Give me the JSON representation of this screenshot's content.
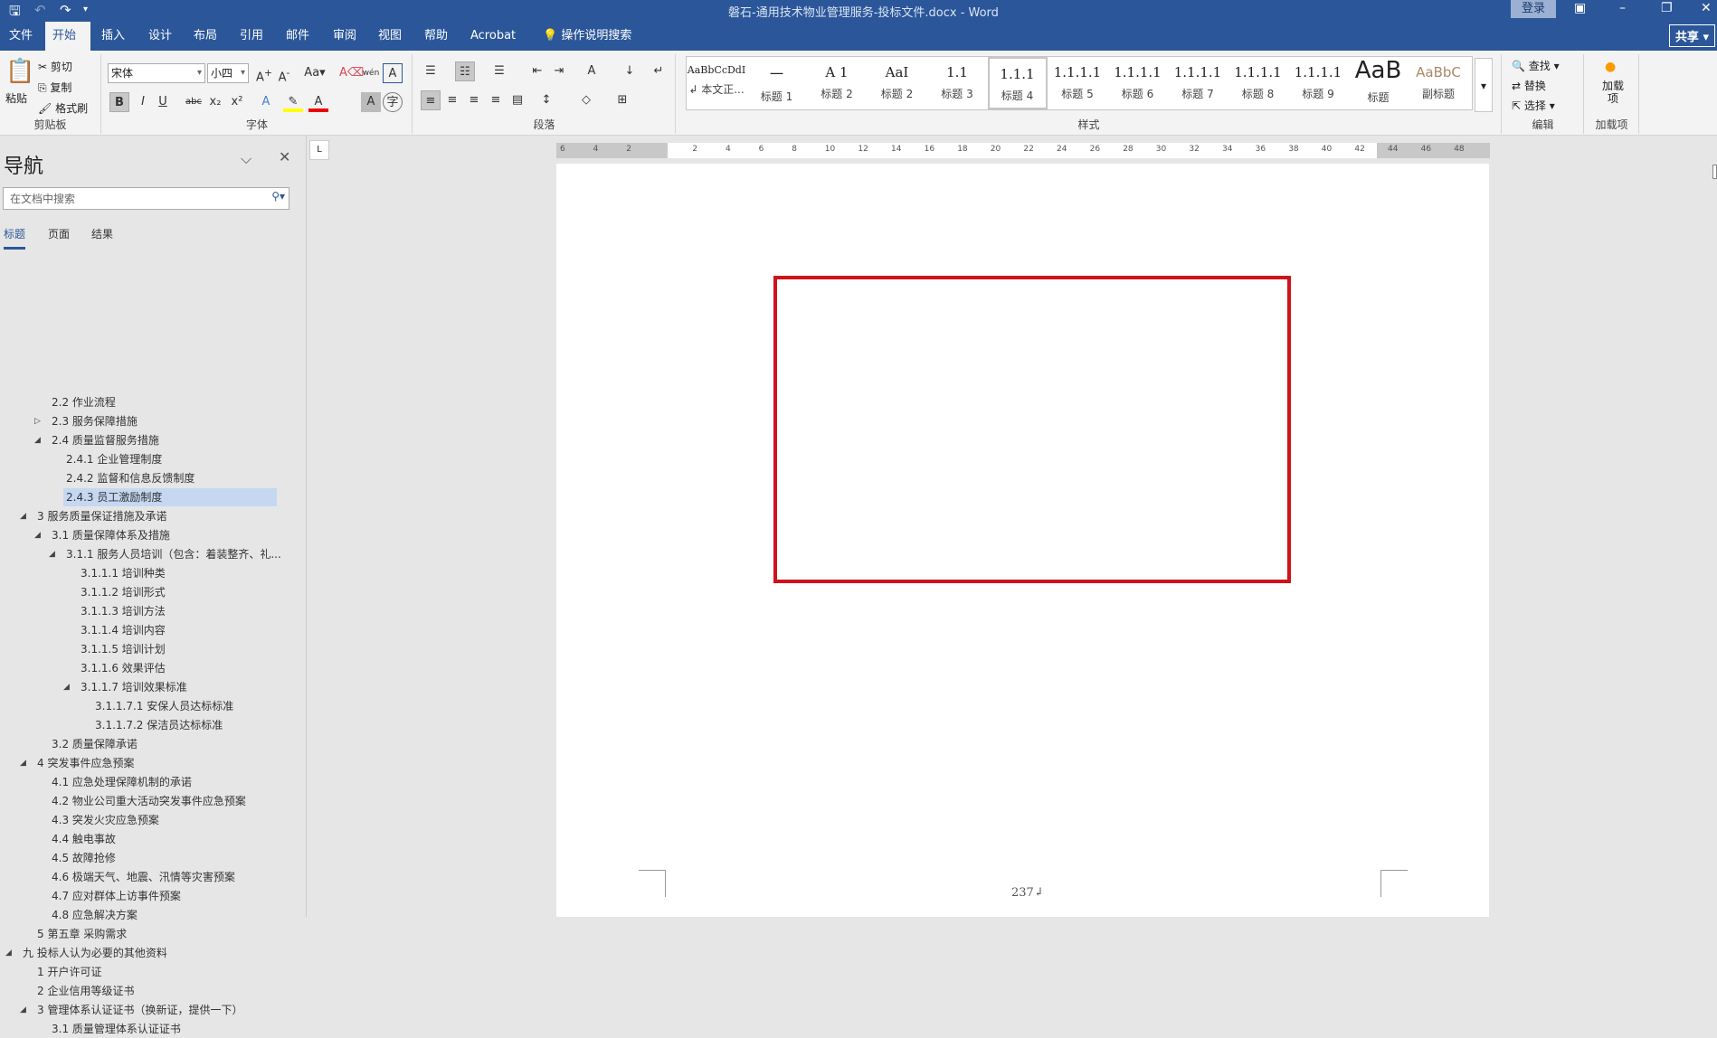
{
  "titlebar": {
    "title": "磐石-通用技术物业管理服务-投标文件.docx  -  Word",
    "login": "登录",
    "qat": {
      "save": "🖫",
      "undo": "↶",
      "redo": "↷",
      "customize": "▾"
    }
  },
  "tabs": [
    "文件",
    "开始",
    "插入",
    "设计",
    "布局",
    "引用",
    "邮件",
    "审阅",
    "视图",
    "帮助",
    "Acrobat"
  ],
  "tell_me": "操作说明搜索",
  "share": "共享",
  "clipboard": {
    "paste": "粘贴",
    "cut": "剪切",
    "copy": "复制",
    "format_painter": "格式刷",
    "label": "剪贴板"
  },
  "font": {
    "name": "宋体",
    "size": "小四",
    "label": "字体"
  },
  "paragraph": {
    "label": "段落"
  },
  "styles": {
    "label": "样式",
    "items": [
      {
        "preview": "AaBbCcDdI",
        "name": "↲ 本文正..."
      },
      {
        "preview": "一",
        "name": "标题 1"
      },
      {
        "preview": "A 1",
        "name": "标题 2"
      },
      {
        "preview": "AaI",
        "name": "标题 2"
      },
      {
        "preview": "1.1",
        "name": "标题 3"
      },
      {
        "preview": "1.1.1",
        "name": "标题 4"
      },
      {
        "preview": "1.1.1.1",
        "name": "标题 5"
      },
      {
        "preview": "1.1.1.1",
        "name": "标题 6"
      },
      {
        "preview": "1.1.1.1",
        "name": "标题 7"
      },
      {
        "preview": "1.1.1.1",
        "name": "标题 8"
      },
      {
        "preview": "1.1.1.1",
        "name": "标题 9"
      },
      {
        "preview": "AaB",
        "name": "标题"
      },
      {
        "preview": "AaBbC",
        "name": "副标题"
      }
    ]
  },
  "editing": {
    "find": "查找",
    "replace": "替换",
    "select": "选择",
    "label": "编辑"
  },
  "addins": {
    "button": "加载项",
    "label": "加载项"
  },
  "nav": {
    "title": "导航",
    "search_placeholder": "在文档中搜索",
    "tabs": [
      "标题",
      "页面",
      "结果"
    ],
    "items": [
      {
        "t": "2.2 作业流程",
        "l": 2,
        "a": ""
      },
      {
        "t": "2.3 服务保障措施",
        "l": 2,
        "a": "▷"
      },
      {
        "t": "2.4 质量监督服务措施",
        "l": 2,
        "a": "◢"
      },
      {
        "t": "2.4.1 企业管理制度",
        "l": 3,
        "a": ""
      },
      {
        "t": "2.4.2 监督和信息反馈制度",
        "l": 3,
        "a": ""
      },
      {
        "t": "2.4.3 员工激励制度",
        "l": 3,
        "a": "",
        "sel": true
      },
      {
        "t": "3 服务质量保证措施及承诺",
        "l": 1,
        "a": "◢"
      },
      {
        "t": "3.1 质量保障体系及措施",
        "l": 2,
        "a": "◢"
      },
      {
        "t": "3.1.1 服务人员培训（包含：着装整齐、礼...",
        "l": 3,
        "a": "◢"
      },
      {
        "t": "3.1.1.1 培训种类",
        "l": 4,
        "a": ""
      },
      {
        "t": "3.1.1.2 培训形式",
        "l": 4,
        "a": ""
      },
      {
        "t": "3.1.1.3 培训方法",
        "l": 4,
        "a": ""
      },
      {
        "t": "3.1.1.4 培训内容",
        "l": 4,
        "a": ""
      },
      {
        "t": "3.1.1.5 培训计划",
        "l": 4,
        "a": ""
      },
      {
        "t": "3.1.1.6 效果评估",
        "l": 4,
        "a": ""
      },
      {
        "t": "3.1.1.7 培训效果标准",
        "l": 4,
        "a": "◢"
      },
      {
        "t": "3.1.1.7.1 安保人员达标标准",
        "l": 5,
        "a": ""
      },
      {
        "t": "3.1.1.7.2 保洁员达标标准",
        "l": 5,
        "a": ""
      },
      {
        "t": "3.2 质量保障承诺",
        "l": 2,
        "a": ""
      },
      {
        "t": "4 突发事件应急预案",
        "l": 1,
        "a": "◢"
      },
      {
        "t": "4.1 应急处理保障机制的承诺",
        "l": 2,
        "a": ""
      },
      {
        "t": "4.2 物业公司重大活动突发事件应急预案",
        "l": 2,
        "a": ""
      },
      {
        "t": "4.3 突发火灾应急预案",
        "l": 2,
        "a": ""
      },
      {
        "t": "4.4 触电事故",
        "l": 2,
        "a": ""
      },
      {
        "t": "4.5 故障抢修",
        "l": 2,
        "a": ""
      },
      {
        "t": "4.6 极端天气、地震、汛情等灾害预案",
        "l": 2,
        "a": ""
      },
      {
        "t": "4.7 应对群体上访事件预案",
        "l": 2,
        "a": ""
      },
      {
        "t": "4.8 应急解决方案",
        "l": 2,
        "a": ""
      },
      {
        "t": "5 第五章 采购需求",
        "l": 1,
        "a": ""
      },
      {
        "t": "九 投标人认为必要的其他资料",
        "l": 0,
        "a": "◢"
      },
      {
        "t": "1 开户许可证",
        "l": 1,
        "a": ""
      },
      {
        "t": "2 企业信用等级证书",
        "l": 1,
        "a": ""
      },
      {
        "t": "3 管理体系认证证书（换新证，提供一下）",
        "l": 1,
        "a": "◢"
      },
      {
        "t": "3.1 质量管理体系认证证书",
        "l": 2,
        "a": ""
      }
    ]
  },
  "ruler": [
    "6",
    "4",
    "2",
    "",
    "2",
    "4",
    "6",
    "8",
    "10",
    "12",
    "14",
    "16",
    "18",
    "20",
    "22",
    "24",
    "26",
    "28",
    "30",
    "32",
    "34",
    "36",
    "38",
    "40",
    "42",
    "44",
    "46",
    "48"
  ],
  "page": {
    "number": "237↲"
  },
  "colors": {
    "accent": "#2b579a",
    "highlight": "#c5d7f1",
    "red_box": "#d0121b"
  }
}
